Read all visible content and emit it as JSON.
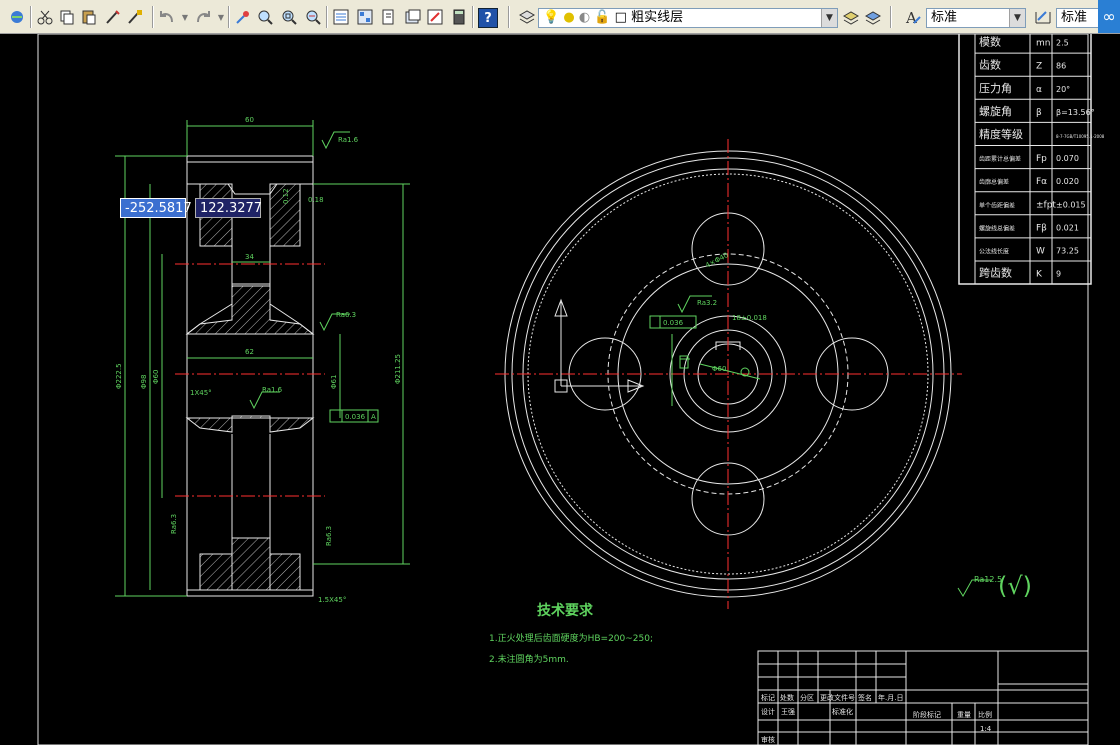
{
  "toolbar": {
    "layer_name": "粗实线层",
    "text_style": "标准",
    "dim_style": "标准",
    "help_label": "?",
    "icons": [
      "open-icon",
      "cut-icon",
      "copy-icon",
      "paste-icon",
      "matchprop-icon",
      "brush-icon",
      "undo-icon",
      "redo-icon",
      "pan-icon",
      "zoom-realtime-icon",
      "zoom-window-icon",
      "zoom-previous-icon",
      "properties-icon",
      "designcenter-icon",
      "toolpalette-icon",
      "markup-icon",
      "calculator-icon",
      "help-icon",
      "layer-manager-icon",
      "lightbulb-icon",
      "sun-icon",
      "lock-icon",
      "color-icon",
      "layer-previous-icon",
      "layer-state-icon",
      "text-style-icon",
      "dim-style-icon"
    ]
  },
  "coords": {
    "x": "-252.5817",
    "y": "122.3277"
  },
  "param_table": {
    "rows": [
      {
        "name": "模数",
        "symbol": "mn",
        "value": "2.5"
      },
      {
        "name": "齿数",
        "symbol": "Z",
        "value": "86"
      },
      {
        "name": "压力角",
        "symbol": "α",
        "value": "20°"
      },
      {
        "name": "螺旋角",
        "symbol": "β",
        "value": "β=13.56°"
      },
      {
        "name": "精度等级",
        "symbol": "",
        "value": "8-7-7GB/T10095.1-2008"
      },
      {
        "name": "齿距累计总偏差",
        "symbol": "Fp",
        "value": "0.070"
      },
      {
        "name": "齿廓总偏差",
        "symbol": "Fα",
        "value": "0.020"
      },
      {
        "name": "单个齿距偏差",
        "symbol": "±fpt",
        "value": "±0.015"
      },
      {
        "name": "螺旋线总偏差",
        "symbol": "Fβ",
        "value": "0.021"
      },
      {
        "name": "公法线长度",
        "symbol": "W",
        "value": "73.25"
      },
      {
        "name": "跨齿数",
        "symbol": "K",
        "value": "9"
      }
    ]
  },
  "dims": {
    "width_top": "60",
    "rough_top": "Ra1.6",
    "hub_width": "34",
    "bore_width": "62",
    "chamfer": "1X45°",
    "rough_bore": "Ra1.6",
    "rough_mid": "Ra6.3",
    "tol_val": "0.12",
    "tol_val2": "0.18",
    "runout": "0.036",
    "runout_ref": "A",
    "dia_big": "Φ222.5",
    "dia_mid": "Φ215",
    "dia_root": "Φ211.25",
    "dia_hub": "Φ98",
    "dia_bore": "Φ60",
    "dia_bore2": "Φ61",
    "keyway": "64",
    "rough_left_low": "Ra6.3",
    "rough_right_low": "Ra6.3",
    "bottom_chamfer": "1.5X45°",
    "rough_key": "Ra3.2",
    "key_tol": "0.036",
    "key_sym": "18±0.018",
    "hole_dia": "4×Φ40",
    "bore_label": "Φ60",
    "surface_rough": "Ra12.5"
  },
  "notes": {
    "title": "技术要求",
    "line1": "1.正火处理后齿面硬度为HB=200~250;",
    "line2": "2.未注圆角为5mm."
  },
  "title_block": {
    "scale": "1:4",
    "c1": "标记",
    "c2": "处数",
    "c3": "分区",
    "c4": "更改文件号",
    "c5": "签名",
    "c6": "年.月.日",
    "design": "设计",
    "std": "标准化",
    "stage": "阶段标记",
    "weight": "重量",
    "ratio": "比例",
    "reviewer": "王强",
    "audit": "审核"
  },
  "colors": {
    "draw_green": "#5fd35f",
    "draw_white": "#e8e8e8",
    "center_red": "#ff3030",
    "bg": "#000000"
  }
}
